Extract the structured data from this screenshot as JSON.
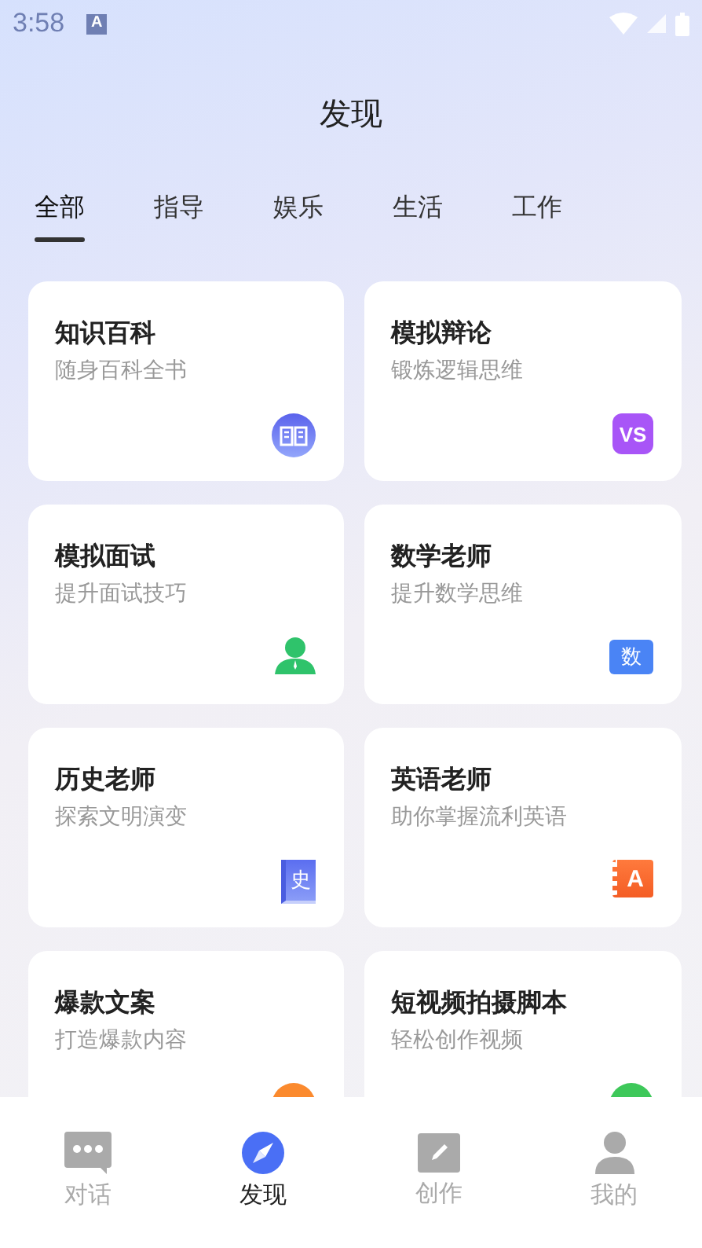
{
  "status_bar": {
    "time": "3:58",
    "notification_label": "A"
  },
  "header": {
    "title": "发现"
  },
  "tabs": [
    {
      "label": "全部",
      "selected": true
    },
    {
      "label": "指导",
      "selected": false
    },
    {
      "label": "娱乐",
      "selected": false
    },
    {
      "label": "生活",
      "selected": false
    },
    {
      "label": "工作",
      "selected": false
    }
  ],
  "cards": [
    {
      "title": "知识百科",
      "subtitle": "随身百科全书",
      "kind": "book"
    },
    {
      "title": "模拟辩论",
      "subtitle": "锻炼逻辑思维",
      "kind": "text-tile",
      "icon_label": "VS",
      "color": "#a855f7"
    },
    {
      "title": "模拟面试",
      "subtitle": "提升面试技巧",
      "kind": "person"
    },
    {
      "title": "数学老师",
      "subtitle": "提升数学思维",
      "kind": "folder",
      "icon_label": "数"
    },
    {
      "title": "历史老师",
      "subtitle": "探索文明演变",
      "kind": "volume",
      "icon_label": "史"
    },
    {
      "title": "英语老师",
      "subtitle": "助你掌握流利英语",
      "kind": "notebook",
      "icon_label": "A"
    },
    {
      "title": "爆款文案",
      "subtitle": "打造爆款内容",
      "kind": "round",
      "color": "#fb8a2e"
    },
    {
      "title": "短视频拍摄脚本",
      "subtitle": "轻松创作视频",
      "kind": "round",
      "color": "#3ec85a"
    }
  ],
  "bottom_nav": [
    {
      "label": "对话",
      "kind": "chat",
      "selected": false
    },
    {
      "label": "发现",
      "kind": "compass",
      "selected": true
    },
    {
      "label": "创作",
      "kind": "edit",
      "selected": false
    },
    {
      "label": "我的",
      "kind": "user",
      "selected": false
    }
  ]
}
